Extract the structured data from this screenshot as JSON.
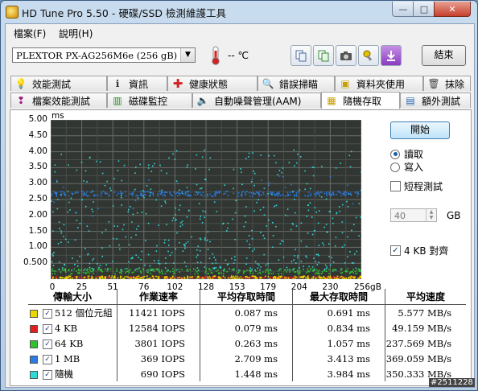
{
  "window": {
    "title": "HD Tune Pro 5.50 - 硬碟/SSD 檢測維護工具",
    "min_glyph": "—",
    "max_glyph": "□",
    "close_glyph": "✕"
  },
  "menu": [
    {
      "label": "檔案(F)"
    },
    {
      "label": "說明(H)"
    }
  ],
  "toolbar": {
    "drive": "PLEXTOR PX-AG256M6e (256 gB)",
    "temperature": "-- ℃",
    "exit_label": "結束",
    "icons": [
      "copy-icon",
      "copy-all-icon",
      "camera-icon",
      "tools-icon",
      "download-icon"
    ]
  },
  "tabs_row1": [
    {
      "label": "效能測試",
      "icon": "bulb-icon"
    },
    {
      "label": "資訊",
      "icon": "info-icon"
    },
    {
      "label": "健康狀態",
      "icon": "health-cross-icon"
    },
    {
      "label": "錯誤掃瞄",
      "icon": "magnifier-icon"
    },
    {
      "label": "資料夾使用",
      "icon": "folder-icon"
    },
    {
      "label": "抹除",
      "icon": "trash-icon"
    }
  ],
  "tabs_row2": [
    {
      "label": "檔案效能測試",
      "icon": "file-benchmark-icon"
    },
    {
      "label": "磁碟監控",
      "icon": "monitor-icon"
    },
    {
      "label": "自動噪聲管理(AAM)",
      "icon": "speaker-icon"
    },
    {
      "label": "隨機存取",
      "icon": "random-access-icon",
      "active": true
    },
    {
      "label": "額外測試",
      "icon": "extra-tests-icon"
    }
  ],
  "controls": {
    "start_label": "開始",
    "read_label": "讀取",
    "write_label": "寫入",
    "read_selected": true,
    "short_test_label": "短程測試",
    "short_test_checked": false,
    "short_test_size": "40",
    "size_unit": "GB",
    "align_label": "4 KB 對齊",
    "align_checked": true
  },
  "chart_data": {
    "type": "scatter",
    "title": "",
    "xlabel": "",
    "ylabel": "ms",
    "x_unit": "gB",
    "xlim": [
      0,
      256
    ],
    "ylim": [
      0,
      5
    ],
    "grid": true,
    "yticks": [
      "5.00",
      "4.50",
      "4.00",
      "3.50",
      "3.00",
      "2.50",
      "2.00",
      "1.50",
      "1.00",
      "0.500"
    ],
    "xticks": [
      "0",
      "25",
      "51",
      "76",
      "102",
      "128",
      "153",
      "179",
      "204",
      "230",
      "256gB"
    ],
    "series": [
      {
        "name": "512 個位元組",
        "color": "#e8d800",
        "band": [
          0.02,
          0.12
        ],
        "count": 300
      },
      {
        "name": "4 KB",
        "color": "#e02020",
        "band": [
          0.05,
          0.1
        ],
        "count": 260
      },
      {
        "name": "64 KB",
        "color": "#30c030",
        "band": [
          0.18,
          0.35
        ],
        "count": 260
      },
      {
        "name": "1 MB",
        "color": "#2a7ae0",
        "band": [
          2.62,
          2.78
        ],
        "count": 320
      },
      {
        "name": "隨機",
        "color": "#30d8d8",
        "band": [
          0.3,
          4.1
        ],
        "count": 520
      }
    ]
  },
  "results": {
    "headers": [
      "傳輸大小",
      "作業速率",
      "平均存取時間",
      "最大存取時間",
      "平均速度"
    ],
    "rows": [
      {
        "size": "512 個位元組",
        "color": "#e8d800",
        "rate": "11421 IOPS",
        "avg": "0.087 ms",
        "max": "0.691 ms",
        "speed": "5.577 MB/s"
      },
      {
        "size": "4 KB",
        "color": "#e02020",
        "rate": "12584 IOPS",
        "avg": "0.079 ms",
        "max": "0.834 ms",
        "speed": "49.159 MB/s"
      },
      {
        "size": "64 KB",
        "color": "#30c030",
        "rate": "3801 IOPS",
        "avg": "0.263 ms",
        "max": "1.057 ms",
        "speed": "237.569 MB/s"
      },
      {
        "size": "1 MB",
        "color": "#2a7ae0",
        "rate": "369 IOPS",
        "avg": "2.709 ms",
        "max": "3.413 ms",
        "speed": "369.059 MB/s"
      },
      {
        "size": "隨機",
        "color": "#30d8d8",
        "rate": "690 IOPS",
        "avg": "1.448 ms",
        "max": "3.984 ms",
        "speed": "350.333 MB/s"
      }
    ]
  },
  "watermark": "#2511228"
}
